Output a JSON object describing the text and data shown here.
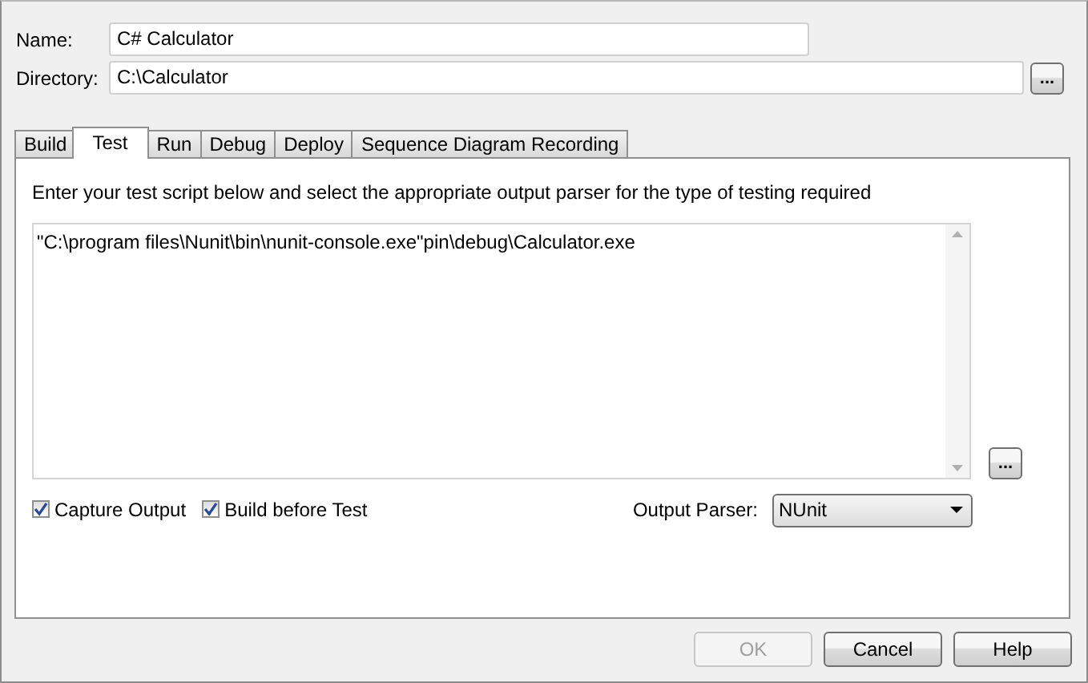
{
  "fields": [
    {
      "label": "Name:",
      "value": "C# Calculator",
      "browse": false
    },
    {
      "label": "Directory:",
      "value": "C:\\Calculator",
      "browse": true,
      "browse_label": "..."
    }
  ],
  "tabs": [
    {
      "label": "Build",
      "selected": false
    },
    {
      "label": "Test",
      "selected": true
    },
    {
      "label": "Run",
      "selected": false
    },
    {
      "label": "Debug",
      "selected": false
    },
    {
      "label": "Deploy",
      "selected": false
    },
    {
      "label": "Sequence Diagram Recording",
      "selected": false
    }
  ],
  "test_panel": {
    "instructions": "Enter your test script below and select the appropriate output parser for the type of testing required",
    "script": "\"C:\\program files\\Nunit\\bin\\nunit-console.exe\"pin\\debug\\Calculator.exe",
    "browse_label": "...",
    "checkboxes": [
      {
        "label": "Capture Output",
        "checked": true
      },
      {
        "label": "Build before Test",
        "checked": true
      }
    ],
    "output_parser": {
      "label": "Output Parser:",
      "value": "NUnit"
    }
  },
  "buttons": [
    {
      "label": "OK",
      "disabled": true
    },
    {
      "label": "Cancel",
      "disabled": false
    },
    {
      "label": "Help",
      "disabled": false
    }
  ]
}
